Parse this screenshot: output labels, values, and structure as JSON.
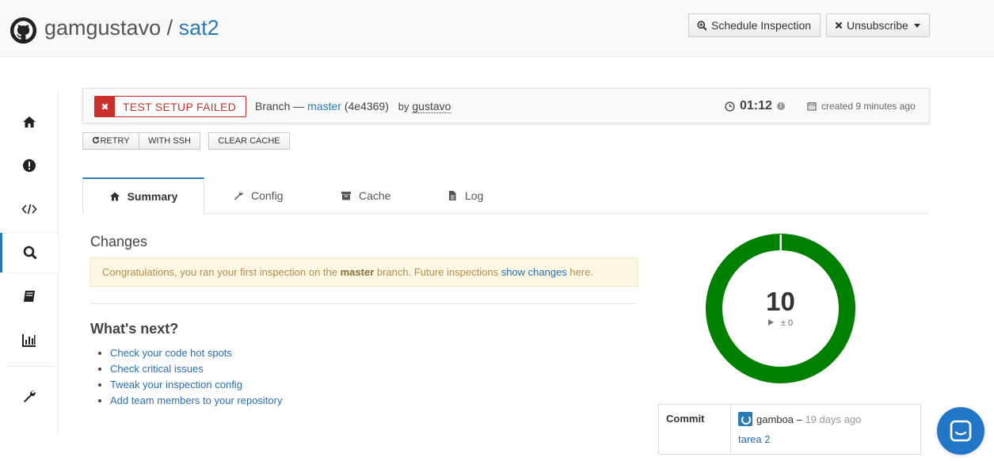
{
  "header": {
    "owner": "gamgustavo",
    "separator": " / ",
    "repo": "sat2",
    "schedule_label": "Schedule Inspection",
    "unsubscribe_label": "Unsubscribe"
  },
  "sidebar": {
    "items": [
      {
        "name": "home-icon"
      },
      {
        "name": "exclamation-icon"
      },
      {
        "name": "code-icon"
      },
      {
        "name": "search-icon",
        "active": true
      },
      {
        "name": "book-icon"
      },
      {
        "name": "bar-chart-icon"
      },
      {
        "name": "wrench-icon"
      }
    ]
  },
  "status": {
    "badge": "TEST SETUP FAILED",
    "branch_prefix": "Branch —",
    "branch": "master",
    "commit": "(4e4369)",
    "by": "by",
    "user": "gustavo",
    "duration": "01:12",
    "created": "created 9 minutes ago"
  },
  "actions": {
    "retry": "RETRY",
    "ssh": "WITH SSH",
    "clear_cache": "CLEAR CACHE"
  },
  "tabs": [
    {
      "label": "Summary",
      "icon": "home-icon",
      "active": true
    },
    {
      "label": "Config",
      "icon": "wrench-icon"
    },
    {
      "label": "Cache",
      "icon": "archive-icon"
    },
    {
      "label": "Log",
      "icon": "file-icon"
    }
  ],
  "changes": {
    "title": "Changes",
    "notice_pre": "Congratulations, you ran your first inspection on the ",
    "notice_branch": "master",
    "notice_mid": " branch. Future inspections ",
    "notice_link": "show changes",
    "notice_post": " here."
  },
  "next": {
    "title": "What's next?",
    "items": [
      "Check your code hot spots",
      "Check critical issues",
      "Tweak your inspection config",
      "Add team members to your repository"
    ]
  },
  "score": {
    "value": "10",
    "delta": "± 0",
    "fraction": 1.0,
    "color": "#008000"
  },
  "commit": {
    "label": "Commit",
    "author": "gamboa",
    "dash": " – ",
    "ago": "19 days ago",
    "message": "tarea 2"
  },
  "colors": {
    "accent": "#2a7bb8",
    "danger": "#c9302c",
    "success": "#008000"
  }
}
